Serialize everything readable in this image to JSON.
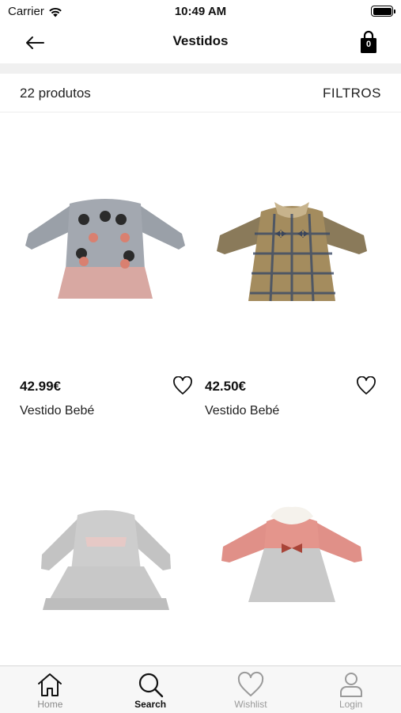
{
  "status_bar": {
    "carrier": "Carrier",
    "time": "10:49 AM"
  },
  "nav": {
    "title": "Vestidos",
    "cart_count": "0"
  },
  "filter_bar": {
    "count_label": "22 produtos",
    "filter_label": "FILTROS"
  },
  "products": [
    {
      "price": "42.99€",
      "name": "Vestido Bebé"
    },
    {
      "price": "42.50€",
      "name": "Vestido Bebé"
    },
    {
      "price": "",
      "name": ""
    },
    {
      "price": "",
      "name": ""
    }
  ],
  "tabs": [
    {
      "label": "Home",
      "icon": "home-icon"
    },
    {
      "label": "Search",
      "icon": "search-icon"
    },
    {
      "label": "Wishlist",
      "icon": "heart-icon"
    },
    {
      "label": "Login",
      "icon": "user-icon"
    }
  ],
  "colors": {
    "accent": "#000000",
    "divider": "#f0f0f0",
    "tab_bar": "#f7f7f7"
  }
}
